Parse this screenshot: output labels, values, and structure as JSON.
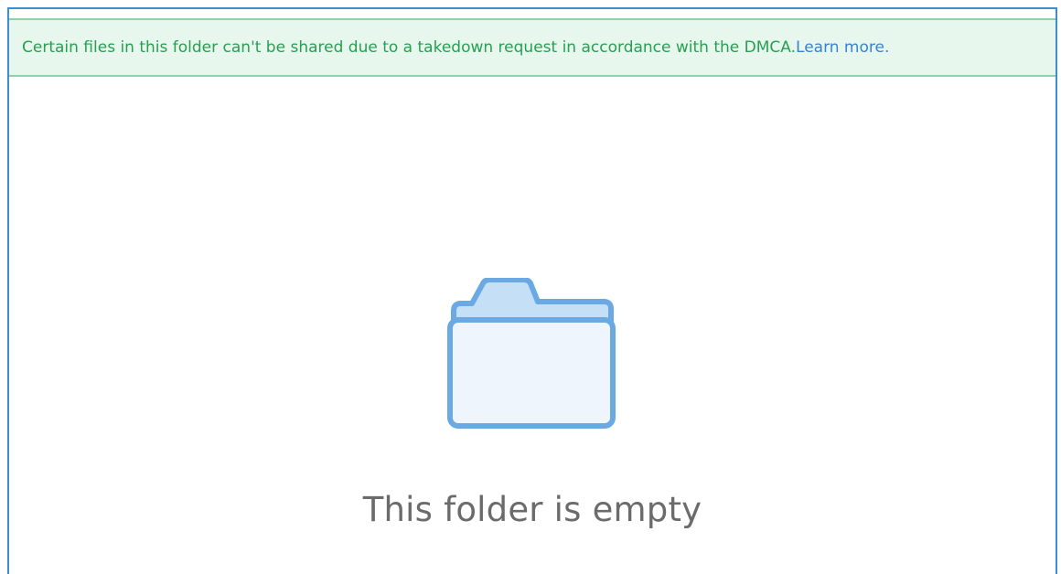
{
  "banner": {
    "message": "Certain files in this folder can't be shared due to a takedown request in accordance with the DMCA.",
    "link_label": "Learn more",
    "trailing": ".",
    "text_color": "#27a052",
    "background_color": "#e8f7ee",
    "link_color": "#3584d4"
  },
  "empty_state": {
    "icon": "folder-icon",
    "message": "This folder is empty",
    "icon_stroke_color": "#6aa9e2",
    "icon_fill_color": "#eef5fd",
    "icon_tab_color": "#c5dff7"
  }
}
